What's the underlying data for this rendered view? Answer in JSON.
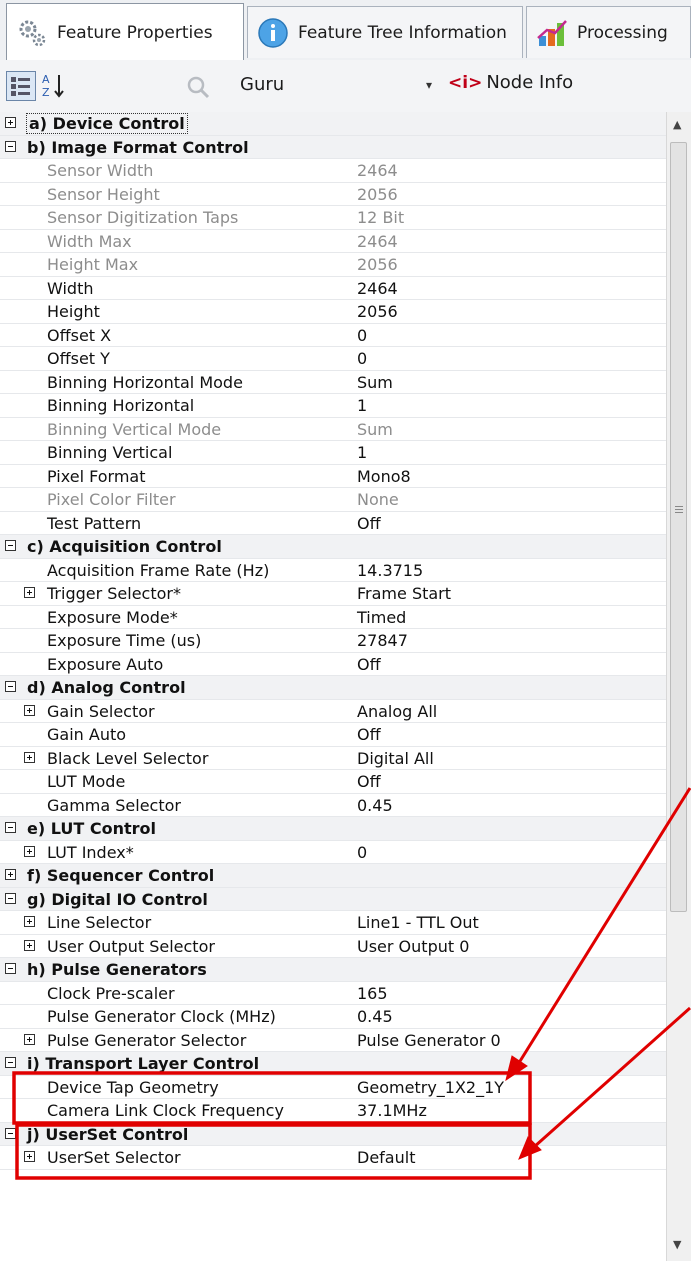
{
  "tabs": [
    {
      "label": "Feature Properties",
      "icon": "gear-icon"
    },
    {
      "label": "Feature Tree Information",
      "icon": "info-icon"
    },
    {
      "label": "Processing",
      "icon": "chart-icon"
    }
  ],
  "toolbar": {
    "visibility": "Guru",
    "node_info_tag": "<i>",
    "node_info_label": "Node Info"
  },
  "rows": [
    {
      "type": "cat",
      "toggle": "plus",
      "name": "a) Device Control",
      "focus": true
    },
    {
      "type": "cat",
      "toggle": "minus",
      "name": "b) Image Format Control"
    },
    {
      "type": "item",
      "name": "Sensor Width",
      "value": "2464",
      "disabled": true
    },
    {
      "type": "item",
      "name": "Sensor Height",
      "value": "2056",
      "disabled": true
    },
    {
      "type": "item",
      "name": "Sensor Digitization Taps",
      "value": "12 Bit",
      "disabled": true
    },
    {
      "type": "item",
      "name": "Width Max",
      "value": "2464",
      "disabled": true
    },
    {
      "type": "item",
      "name": "Height Max",
      "value": "2056",
      "disabled": true
    },
    {
      "type": "item",
      "name": "Width",
      "value": "2464"
    },
    {
      "type": "item",
      "name": "Height",
      "value": "2056"
    },
    {
      "type": "item",
      "name": "Offset X",
      "value": "0"
    },
    {
      "type": "item",
      "name": "Offset Y",
      "value": "0"
    },
    {
      "type": "item",
      "name": "Binning Horizontal Mode",
      "value": "Sum"
    },
    {
      "type": "item",
      "name": "Binning Horizontal",
      "value": "1"
    },
    {
      "type": "item",
      "name": "Binning Vertical Mode",
      "value": "Sum",
      "disabled": true
    },
    {
      "type": "item",
      "name": "Binning Vertical",
      "value": "1"
    },
    {
      "type": "item",
      "name": "Pixel Format",
      "value": "Mono8"
    },
    {
      "type": "item",
      "name": "Pixel Color Filter",
      "value": "None",
      "disabled": true
    },
    {
      "type": "item",
      "name": "Test Pattern",
      "value": "Off"
    },
    {
      "type": "cat",
      "toggle": "minus",
      "name": "c) Acquisition Control"
    },
    {
      "type": "item",
      "name": "Acquisition Frame Rate (Hz)",
      "value": "14.3715"
    },
    {
      "type": "sub",
      "toggle": "plus",
      "name": "Trigger Selector*",
      "value": "Frame Start"
    },
    {
      "type": "item",
      "name": "Exposure Mode*",
      "value": "Timed"
    },
    {
      "type": "item",
      "name": "Exposure Time (us)",
      "value": "27847"
    },
    {
      "type": "item",
      "name": "Exposure Auto",
      "value": "Off"
    },
    {
      "type": "cat",
      "toggle": "minus",
      "name": "d) Analog Control"
    },
    {
      "type": "sub",
      "toggle": "plus",
      "name": "Gain Selector",
      "value": "Analog All"
    },
    {
      "type": "item",
      "name": "Gain Auto",
      "value": "Off"
    },
    {
      "type": "sub",
      "toggle": "plus",
      "name": "Black Level Selector",
      "value": "Digital All"
    },
    {
      "type": "item",
      "name": "LUT Mode",
      "value": "Off"
    },
    {
      "type": "item",
      "name": "Gamma Selector",
      "value": "0.45"
    },
    {
      "type": "cat",
      "toggle": "minus",
      "name": "e) LUT Control"
    },
    {
      "type": "sub",
      "toggle": "plus",
      "name": "LUT Index*",
      "value": "0"
    },
    {
      "type": "cat",
      "toggle": "plus",
      "name": "f) Sequencer Control"
    },
    {
      "type": "cat",
      "toggle": "minus",
      "name": "g) Digital IO Control"
    },
    {
      "type": "sub",
      "toggle": "plus",
      "name": "Line Selector",
      "value": "Line1 - TTL Out"
    },
    {
      "type": "sub",
      "toggle": "plus",
      "name": "User Output Selector",
      "value": "User Output 0"
    },
    {
      "type": "cat",
      "toggle": "minus",
      "name": "h) Pulse Generators"
    },
    {
      "type": "item",
      "name": "Clock Pre-scaler",
      "value": "165"
    },
    {
      "type": "item",
      "name": "Pulse Generator Clock (MHz)",
      "value": "0.45"
    },
    {
      "type": "sub",
      "toggle": "plus",
      "name": "Pulse Generator Selector",
      "value": "Pulse Generator 0"
    },
    {
      "type": "cat",
      "toggle": "minus",
      "name": "i) Transport Layer Control"
    },
    {
      "type": "item",
      "name": "Device Tap Geometry",
      "value": "Geometry_1X2_1Y"
    },
    {
      "type": "item",
      "name": "Camera Link Clock Frequency",
      "value": "37.1MHz"
    },
    {
      "type": "cat",
      "toggle": "minus",
      "name": "j) UserSet Control"
    },
    {
      "type": "sub",
      "toggle": "plus",
      "name": "UserSet Selector",
      "value": "Default"
    }
  ],
  "annotation_color": "#e00000"
}
